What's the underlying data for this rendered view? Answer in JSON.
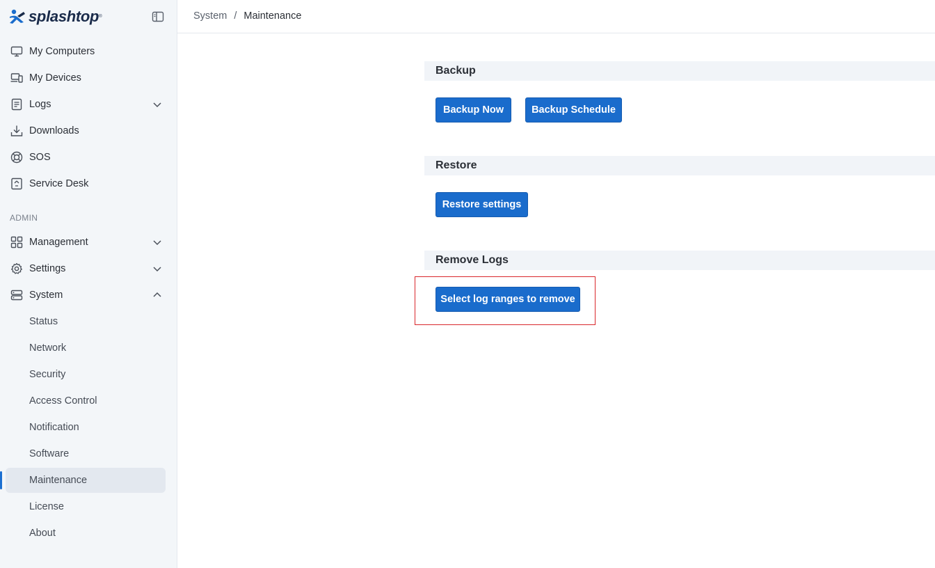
{
  "brand": {
    "name": "splashtop",
    "trademark": "®"
  },
  "sidebar": {
    "items": [
      {
        "label": "My Computers",
        "icon": "monitor-icon"
      },
      {
        "label": "My Devices",
        "icon": "devices-icon"
      },
      {
        "label": "Logs",
        "icon": "logs-icon"
      },
      {
        "label": "Downloads",
        "icon": "download-icon"
      },
      {
        "label": "SOS",
        "icon": "sos-icon"
      },
      {
        "label": "Service Desk",
        "icon": "service-desk-icon"
      }
    ],
    "admin_label": "ADMIN",
    "admin_items": [
      {
        "label": "Management",
        "icon": "grid-icon"
      },
      {
        "label": "Settings",
        "icon": "gear-icon"
      },
      {
        "label": "System",
        "icon": "server-icon"
      }
    ],
    "system_subitems": [
      {
        "label": "Status"
      },
      {
        "label": "Network"
      },
      {
        "label": "Security"
      },
      {
        "label": "Access Control"
      },
      {
        "label": "Notification"
      },
      {
        "label": "Software"
      },
      {
        "label": "Maintenance",
        "active": true
      },
      {
        "label": "License"
      },
      {
        "label": "About"
      }
    ]
  },
  "breadcrumb": {
    "parent": "System",
    "separator": "/",
    "current": "Maintenance"
  },
  "main": {
    "backup": {
      "title": "Backup",
      "backup_now": "Backup Now",
      "backup_schedule": "Backup Schedule"
    },
    "restore": {
      "title": "Restore",
      "restore_settings": "Restore settings"
    },
    "remove_logs": {
      "title": "Remove Logs",
      "select_ranges": "Select log ranges to remove"
    }
  },
  "colors": {
    "accent": "#1a6ccc",
    "highlight": "#d9262b",
    "sidebar_bg": "#f3f6f9",
    "section_bg": "#f1f4f8"
  }
}
